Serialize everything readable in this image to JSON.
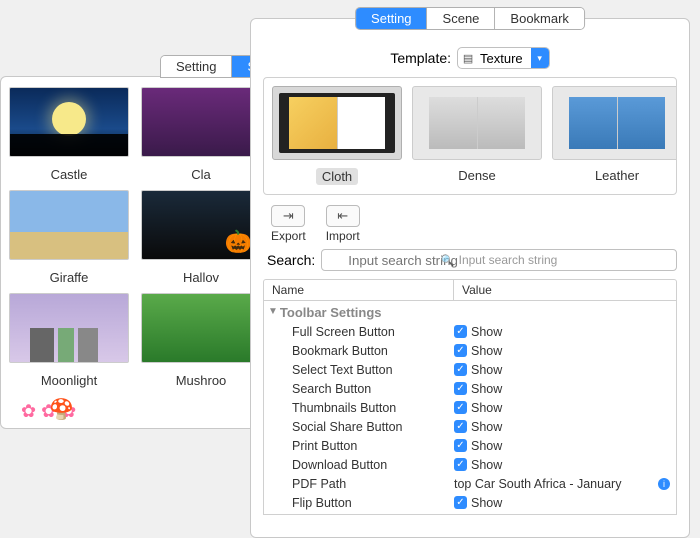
{
  "backWindow": {
    "tabs": [
      "Setting",
      "Scene"
    ],
    "activeTab": "Scene",
    "scenes": [
      {
        "label": "Castle"
      },
      {
        "label": "Classic"
      },
      {
        "label": "Giraffe"
      },
      {
        "label": "Halloween"
      },
      {
        "label": "Moonlight"
      },
      {
        "label": "Mushroom"
      }
    ]
  },
  "frontWindow": {
    "tabs": [
      "Setting",
      "Scene",
      "Bookmark"
    ],
    "activeTab": "Setting",
    "templateLabel": "Template:",
    "templateSelect": "Texture",
    "templates": [
      {
        "label": "Cloth",
        "selected": true
      },
      {
        "label": "Dense",
        "selected": false
      },
      {
        "label": "Leather",
        "selected": false
      }
    ],
    "exportLabel": "Export",
    "importLabel": "Import",
    "searchLabel": "Search:",
    "searchPlaceholder": "Input search string",
    "colName": "Name",
    "colValue": "Value",
    "groupTitle": "Toolbar Settings",
    "showWord": "Show",
    "rows": [
      {
        "name": "Full Screen Button",
        "check": true,
        "value": "Show"
      },
      {
        "name": "Bookmark Button",
        "check": true,
        "value": "Show"
      },
      {
        "name": "Select Text Button",
        "check": true,
        "value": "Show"
      },
      {
        "name": "Search Button",
        "check": true,
        "value": "Show"
      },
      {
        "name": "Thumbnails Button",
        "check": true,
        "value": "Show"
      },
      {
        "name": "Social Share Button",
        "check": true,
        "value": "Show"
      },
      {
        "name": "Print Button",
        "check": true,
        "value": "Show"
      },
      {
        "name": "Download Button",
        "check": true,
        "value": "Show"
      },
      {
        "name": "PDF Path",
        "check": false,
        "value": "top Car South Africa - January",
        "info": true
      },
      {
        "name": "Flip Button",
        "check": true,
        "value": "Show"
      }
    ]
  }
}
